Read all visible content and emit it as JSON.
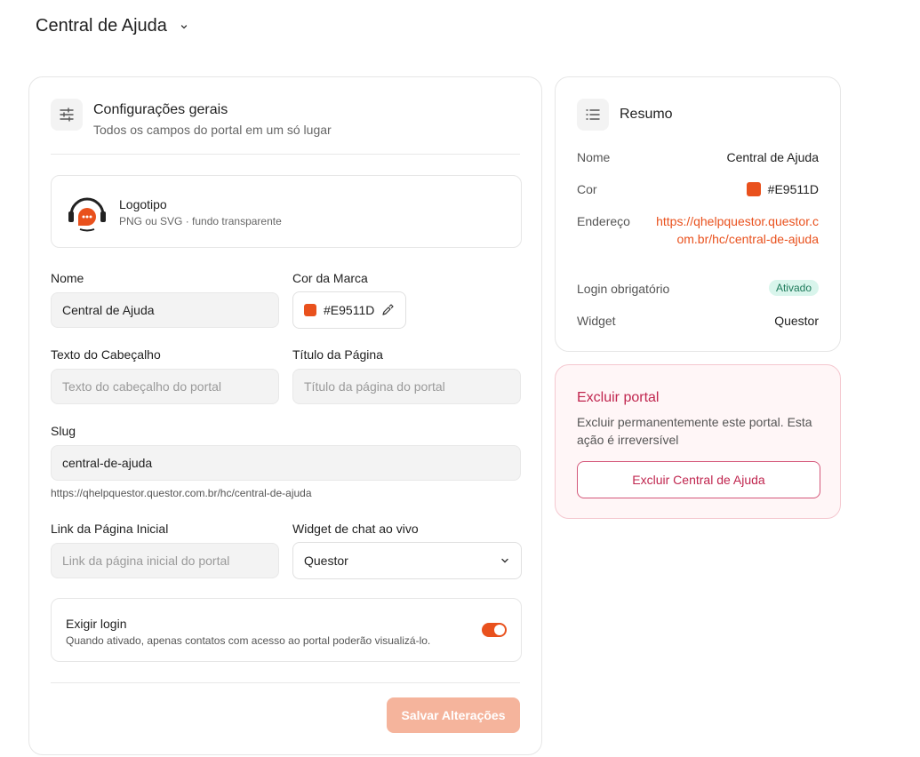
{
  "header": {
    "title": "Central de Ajuda",
    "dropdown_icon": "chevron-down-icon"
  },
  "settings": {
    "title": "Configurações gerais",
    "subtitle": "Todos os campos do portal em um só lugar",
    "icon": "sliders-icon",
    "logo": {
      "title": "Logotipo",
      "subtitle": "PNG ou SVG · fundo transparente"
    },
    "name": {
      "label": "Nome",
      "value": "Central de Ajuda"
    },
    "brand_color": {
      "label": "Cor da Marca",
      "value": "#E9511D",
      "color": "#E9511D"
    },
    "header_text": {
      "label": "Texto do Cabeçalho",
      "placeholder": "Texto do cabeçalho do portal"
    },
    "page_title": {
      "label": "Título da Página",
      "placeholder": "Título da página do portal"
    },
    "slug": {
      "label": "Slug",
      "value": "central-de-ajuda",
      "help": "https://qhelpquestor.questor.com.br/hc/central-de-ajuda"
    },
    "home_link": {
      "label": "Link da Página Inicial",
      "placeholder": "Link da página inicial do portal"
    },
    "chat_widget": {
      "label": "Widget de chat ao vivo",
      "value": "Questor"
    },
    "require_login": {
      "title": "Exigir login",
      "description": "Quando ativado, apenas contatos com acesso ao portal poderão visualizá-lo.",
      "enabled": true
    },
    "save_label": "Salvar Alterações"
  },
  "summary": {
    "title": "Resumo",
    "icon": "list-icon",
    "rows": {
      "name_label": "Nome",
      "name_value": "Central de Ajuda",
      "color_label": "Cor",
      "color_value": "#E9511D",
      "address_label": "Endereço",
      "address_value": "https://qhelpquestor.questor.com.br/hc/central-de-ajuda",
      "login_label": "Login obrigatório",
      "login_value": "Ativado",
      "widget_label": "Widget",
      "widget_value": "Questor"
    }
  },
  "danger": {
    "title": "Excluir portal",
    "description": "Excluir permanentemente este portal. Esta ação é irreversível",
    "button_label": "Excluir Central de Ajuda"
  },
  "colors": {
    "accent": "#E9511D",
    "danger": "#c0264f",
    "success_bg": "#d9f5ec"
  }
}
